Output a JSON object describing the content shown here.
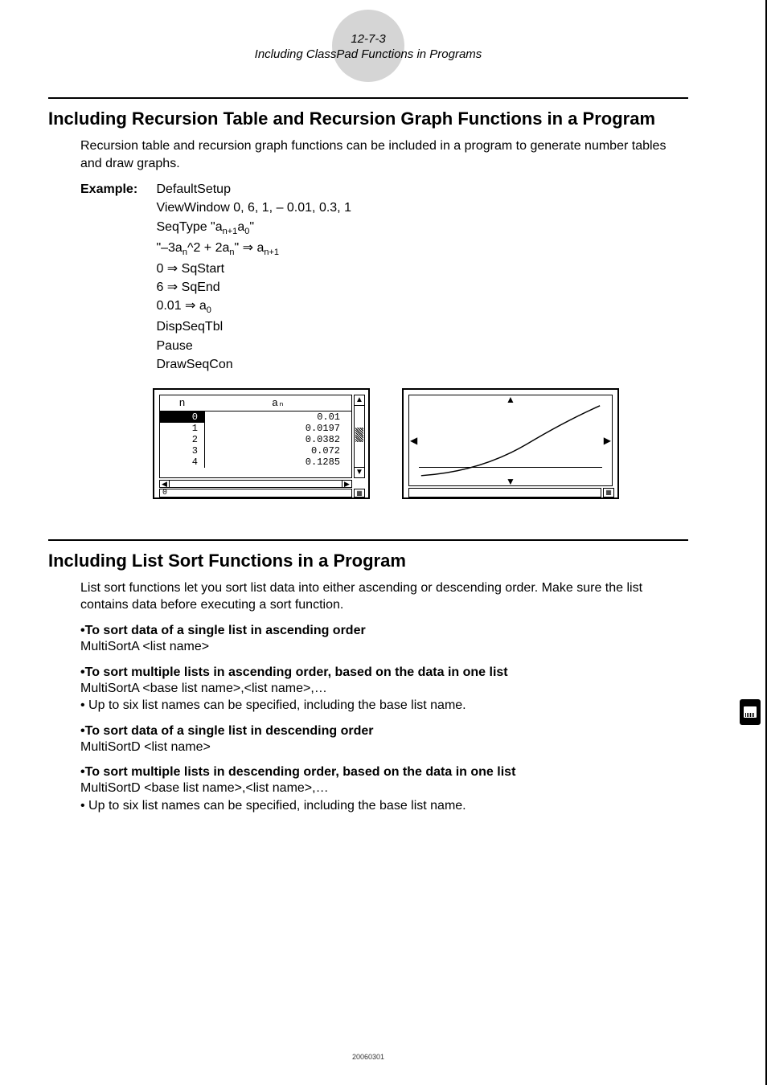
{
  "header": {
    "pagenum": "12-7-3",
    "title": "Including ClassPad Functions in Programs"
  },
  "section1": {
    "title": "Including Recursion Table and Recursion Graph Functions in a Program",
    "intro": "Recursion table and recursion graph functions can be included in a program to generate number tables and draw graphs.",
    "example_label": "Example:",
    "lines": {
      "l0": "DefaultSetup",
      "l1": "ViewWindow 0, 6, 1, – 0.01, 0.3, 1",
      "l2a": "SeqType \"a",
      "l2b": "n+1",
      "l2c": "a",
      "l2d": "0",
      "l2e": "\"",
      "l3a": "\"–3a",
      "l3b": "n",
      "l3c": "^2 + 2a",
      "l3d": "n",
      "l3e": "\" ⇒ a",
      "l3f": "n+1",
      "l4": "0 ⇒ SqStart",
      "l5": "6 ⇒ SqEnd",
      "l6a": "0.01 ⇒ a",
      "l6b": "0",
      "l7": "DispSeqTbl",
      "l8": "Pause",
      "l9": "DrawSeqCon"
    }
  },
  "table_screen": {
    "col_n": "n",
    "col_a": "aₙ",
    "rows": [
      {
        "n": "0",
        "v": "0.01"
      },
      {
        "n": "1",
        "v": "0.0197"
      },
      {
        "n": "2",
        "v": "0.0382"
      },
      {
        "n": "3",
        "v": "0.072"
      },
      {
        "n": "4",
        "v": "0.1285"
      }
    ],
    "status": "0"
  },
  "chart_data": {
    "type": "line",
    "title": "",
    "xlabel": "",
    "ylabel": "",
    "xlim": [
      0,
      6
    ],
    "ylim": [
      -0.01,
      0.3
    ],
    "x": [
      0,
      1,
      2,
      3,
      4,
      5,
      6
    ],
    "values": [
      0.01,
      0.0197,
      0.0382,
      0.072,
      0.1285,
      0.21,
      0.29
    ]
  },
  "section2": {
    "title": "Including List Sort Functions in a Program",
    "intro": "List sort functions let you sort list data into either ascending or descending order. Make sure the list contains data before executing a sort function.",
    "h1": "To sort data of a single list in ascending order",
    "b1": "MultiSortA <list name>",
    "h2": "To sort multiple lists in ascending order, based on the data in one list",
    "b2": "MultiSortA <base list name>,<list name>,…",
    "n2": "• Up to six list names can be specified, including the base list name.",
    "h3": "To sort data of a single list in descending order",
    "b3": "MultiSortD <list name>",
    "h4": "To sort multiple lists in descending order, based on the data in one list",
    "b4": "MultiSortD <base list name>,<list name>,…",
    "n4": "• Up to six list names can be specified, including the base list name."
  },
  "footer": "20060301"
}
